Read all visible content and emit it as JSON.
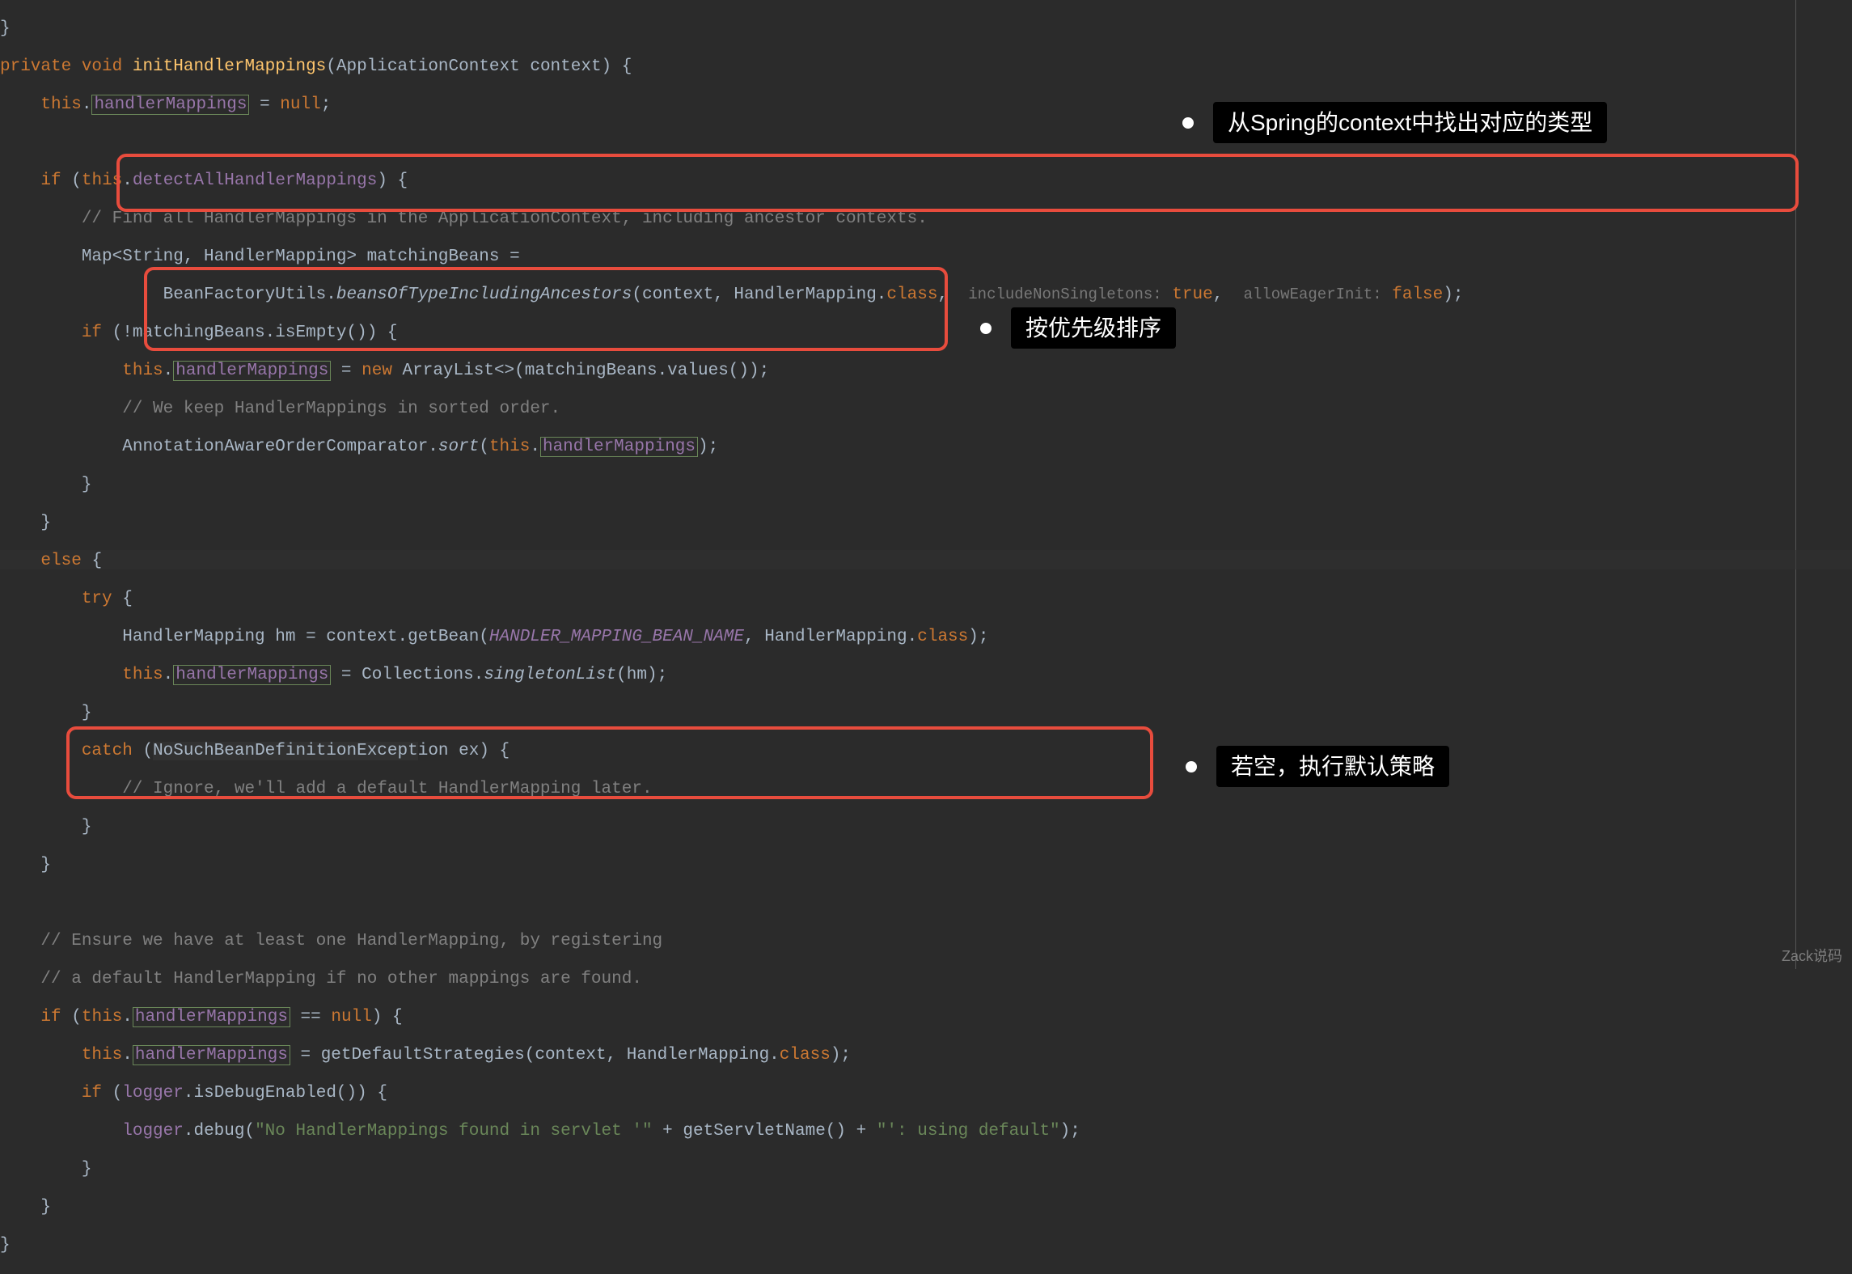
{
  "colors": {
    "background": "#2b2b2b",
    "keyword": "#cc7832",
    "method": "#ffc66d",
    "field": "#9876aa",
    "string": "#6a8759",
    "comment": "#808080",
    "number": "#6897bb",
    "highlight_box": "#e84c3d"
  },
  "annotations": {
    "a1": "从Spring的context中找出对应的类型",
    "a2": "按优先级排序",
    "a3": "若空，执行默认策略"
  },
  "watermark": "Zack说码",
  "code": {
    "l0a": "}",
    "l1_kw1": "private void",
    "l1_m": "initHandlerMappings",
    "l1_p": "(ApplicationContext context) {",
    "l2_this": "this",
    "l2_f": "handlerMappings",
    "l2_rest": " = ",
    "l2_null": "null",
    "l2_end": ";",
    "l4_if": "if",
    "l4_cond_a": " (",
    "l4_this": "this",
    "l4_dot": ".",
    "l4_f": "detectAllHandlerMappings",
    "l4_cond_b": ") {",
    "l5_c": "// Find all HandlerMappings in the ApplicationContext, including ancestor contexts.",
    "l6": "Map<String, HandlerMapping> matchingBeans =",
    "l7_a": "BeanFactoryUtils.",
    "l7_m": "beansOfTypeIncludingAncestors",
    "l7_b": "(context, HandlerMapping.",
    "l7_class": "class",
    "l7_c": ", ",
    "l7_h1": "includeNonSingletons:",
    "l7_v1": "true",
    "l7_d": ", ",
    "l7_h2": "allowEagerInit:",
    "l7_v2": "false",
    "l7_e": ");",
    "l8_if": "if",
    "l8_rest": " (!matchingBeans.isEmpty()) {",
    "l9_this": "this",
    "l9_f": "handlerMappings",
    "l9_a": " = ",
    "l9_new": "new",
    "l9_b": " ArrayList<>(matchingBeans.values());",
    "l10_c": "// We keep HandlerMappings in sorted order.",
    "l11_a": "AnnotationAwareOrderComparator.",
    "l11_m": "sort",
    "l11_b": "(",
    "l11_this": "this",
    "l11_dot": ".",
    "l11_f": "handlerMappings",
    "l11_c": ");",
    "l12": "}",
    "l13": "}",
    "l14_else": "else",
    "l14_b": " {",
    "l15_try": "try",
    "l15_b": " {",
    "l16_a": "HandlerMapping hm = context.getBean(",
    "l16_const": "HANDLER_MAPPING_BEAN_NAME",
    "l16_b": ", HandlerMapping.",
    "l16_class": "class",
    "l16_c": ");",
    "l17_this": "this",
    "l17_f": "handlerMappings",
    "l17_a": " = Collections.",
    "l17_m": "singletonList",
    "l17_b": "(hm);",
    "l18": "}",
    "l19_catch": "catch",
    "l19_a": " (",
    "l19_ex": "NoSuchBeanDefinitionExcept",
    "l19_ion": "ion",
    "l19_b": " ex) {",
    "l20_c": "// Ignore, we'll add a default HandlerMapping later.",
    "l21": "}",
    "l22": "}",
    "l24_c": "// Ensure we have at least one HandlerMapping, by registering",
    "l25_c": "// a default HandlerMapping if no other mappings are found.",
    "l26_if": "if",
    "l26_a": " (",
    "l26_this": "this",
    "l26_dot": ".",
    "l26_f": "handlerMappings",
    "l26_b": " == ",
    "l26_null": "null",
    "l26_c": ") {",
    "l27_this": "this",
    "l27_f": "handlerMappings",
    "l27_a": " = getDefaultStrategies(context, HandlerMapping.",
    "l27_class": "class",
    "l27_b": ");",
    "l28_if": "if",
    "l28_a": " (",
    "l28_f": "logger",
    "l28_b": ".isDebugEnabled()) {",
    "l29_f": "logger",
    "l29_a": ".debug(",
    "l29_s1": "\"No HandlerMappings found in servlet '\"",
    "l29_b": " + getServletName() + ",
    "l29_s2": "\"': using default\"",
    "l29_c": ");",
    "l30": "}",
    "l31": "}",
    "l32": "}"
  }
}
